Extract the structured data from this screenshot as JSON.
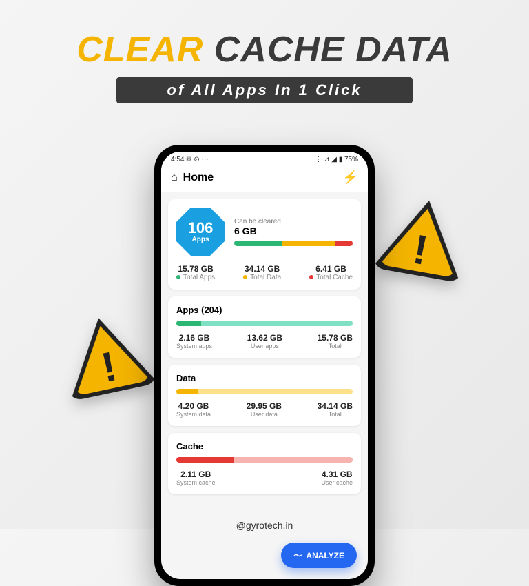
{
  "headline": {
    "word1": "CLEAR",
    "word2": "CACHE DATA"
  },
  "subtitle": "of All Apps In 1 Click",
  "statusbar": {
    "time": "4:54",
    "left_icons": "✉ ⊙ ⋯",
    "right_icons": "⋮ ⊿ ◢ ▮ 75%"
  },
  "appbar": {
    "title": "Home",
    "bolt": "⚡"
  },
  "summary": {
    "apps_count": "106",
    "apps_label": "Apps",
    "clear_label": "Can be cleared",
    "clear_value": "6 GB",
    "bar": [
      {
        "color": "#2bb673",
        "pct": 40
      },
      {
        "color": "#f4b400",
        "pct": 45
      },
      {
        "color": "#e53935",
        "pct": 15
      }
    ],
    "legend": [
      {
        "value": "15.78 GB",
        "label": "Total Apps",
        "dot": "#2bb673"
      },
      {
        "value": "34.14 GB",
        "label": "Total Data",
        "dot": "#f4b400"
      },
      {
        "value": "6.41 GB",
        "label": "Total Cache",
        "dot": "#e53935"
      }
    ]
  },
  "apps_card": {
    "title": "Apps (204)",
    "bar": [
      {
        "color": "#2bb673",
        "pct": 14
      },
      {
        "color": "#7fe0c3",
        "pct": 86
      }
    ],
    "cols": [
      {
        "value": "2.16 GB",
        "label": "System apps"
      },
      {
        "value": "13.62 GB",
        "label": "User apps"
      },
      {
        "value": "15.78 GB",
        "label": "Total"
      }
    ]
  },
  "data_card": {
    "title": "Data",
    "bar": [
      {
        "color": "#f4b400",
        "pct": 12
      },
      {
        "color": "#ffe08a",
        "pct": 88
      }
    ],
    "cols": [
      {
        "value": "4.20 GB",
        "label": "System data"
      },
      {
        "value": "29.95 GB",
        "label": "User data"
      },
      {
        "value": "34.14 GB",
        "label": "Total"
      }
    ]
  },
  "cache_card": {
    "title": "Cache",
    "bar": [
      {
        "color": "#e53935",
        "pct": 33
      },
      {
        "color": "#f7b3b0",
        "pct": 67
      }
    ],
    "cols": [
      {
        "value": "2.11 GB",
        "label": "System cache"
      },
      {
        "value": "4.31 GB",
        "label": "User cache"
      }
    ]
  },
  "fab": {
    "label": "ANALYZE",
    "icon": "〜"
  },
  "watermark": "@gyrotech.in"
}
